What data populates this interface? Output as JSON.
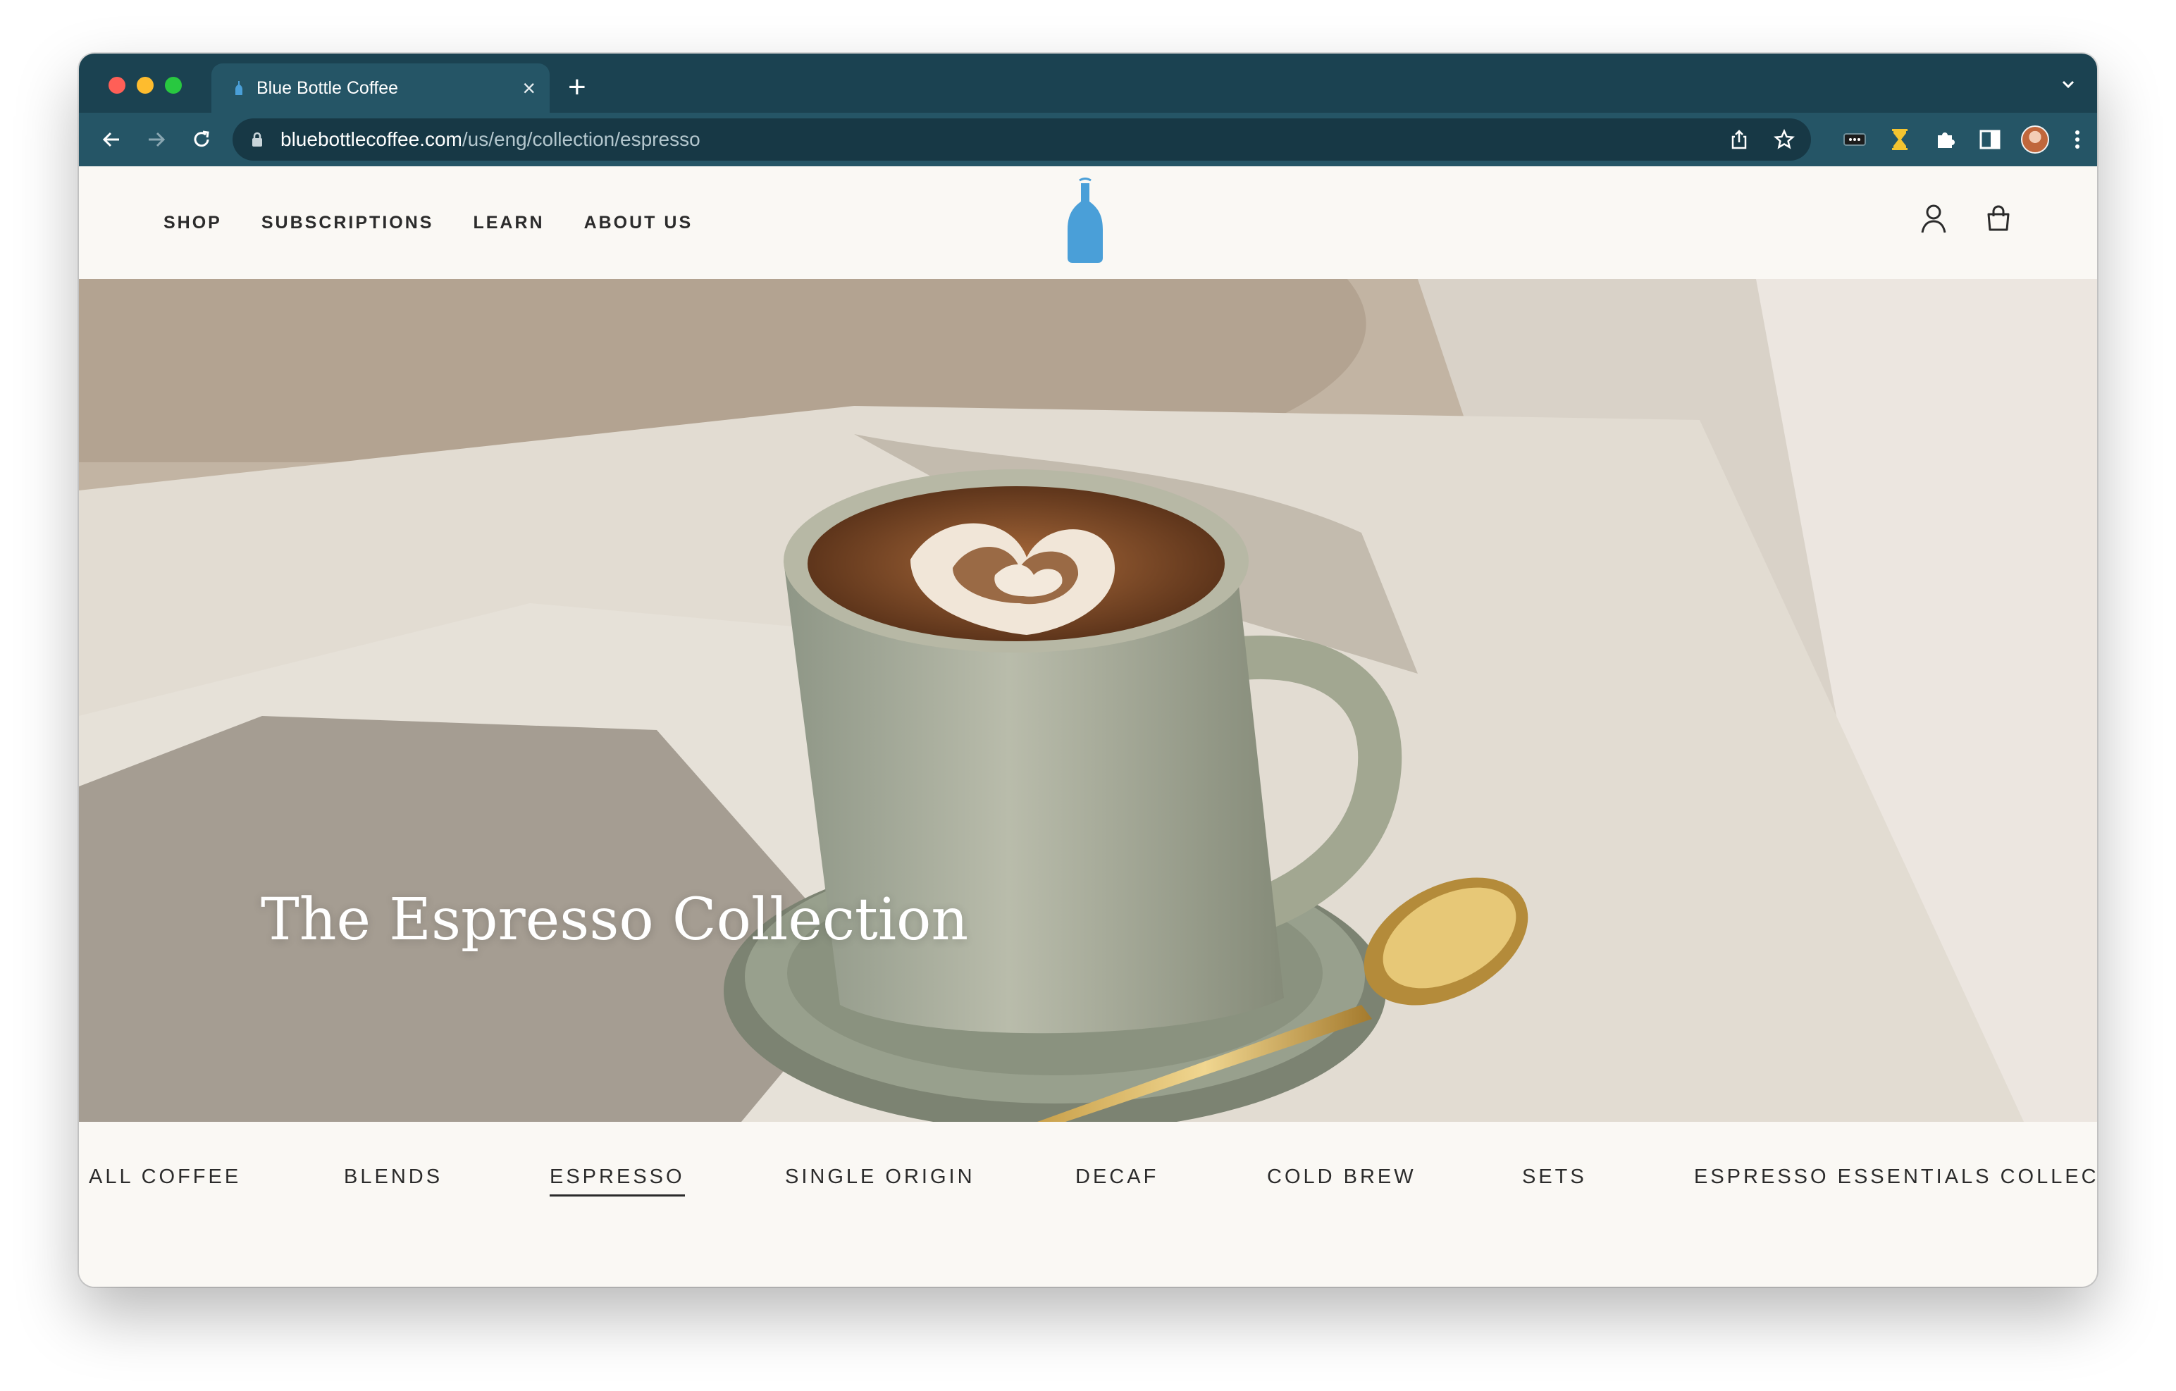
{
  "browser": {
    "tab_title": "Blue Bottle Coffee",
    "url_host": "bluebottlecoffee.com",
    "url_path": "/us/eng/collection/espresso",
    "icons": [
      "back-icon",
      "forward-icon",
      "reload-icon",
      "lock-icon",
      "share-icon",
      "bookmark-star-icon",
      "extension-dots-icon",
      "hourglass-icon",
      "puzzle-icon",
      "side-panel-icon",
      "profile-avatar",
      "menu-kebab-icon",
      "tab-list-chevron-icon"
    ]
  },
  "header": {
    "nav": [
      "SHOP",
      "SUBSCRIPTIONS",
      "LEARN",
      "ABOUT US"
    ],
    "logo_color": "#4a9fd8",
    "icons": [
      "account-icon",
      "cart-icon"
    ]
  },
  "hero": {
    "title": "The Espresso Collection"
  },
  "categories": {
    "items": [
      "ALL COFFEE",
      "BLENDS",
      "ESPRESSO",
      "SINGLE ORIGIN",
      "DECAF",
      "COLD BREW",
      "SETS",
      "ESPRESSO ESSENTIALS COLLECTION"
    ],
    "active": "ESPRESSO"
  },
  "colors": {
    "chrome_bg": "#1b4251",
    "page_bg": "#faf8f4",
    "brand_blue": "#4a9fd8"
  }
}
